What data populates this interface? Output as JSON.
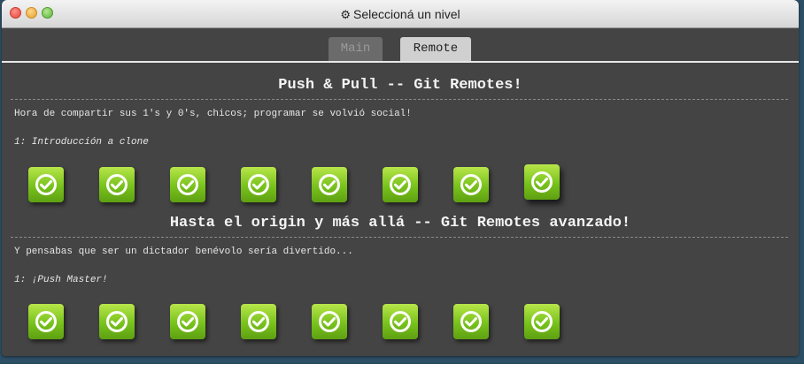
{
  "window": {
    "title_icon": "gear-icon",
    "title": "Seleccioná un nivel"
  },
  "tabs": [
    {
      "label": "Main",
      "active": false
    },
    {
      "label": "Remote",
      "active": true
    }
  ],
  "sections": [
    {
      "title": "Push & Pull -- Git Remotes!",
      "description": "Hora de compartir sus 1's y 0's, chicos; programar se volvió social!",
      "subtitle": "1: Introducción a clone",
      "levels": [
        {
          "status": "completed"
        },
        {
          "status": "completed"
        },
        {
          "status": "completed"
        },
        {
          "status": "completed"
        },
        {
          "status": "completed"
        },
        {
          "status": "completed"
        },
        {
          "status": "completed"
        },
        {
          "status": "completed"
        }
      ]
    },
    {
      "title": "Hasta el origin y más allá -- Git Remotes avanzado!",
      "description": "Y pensabas que ser un dictador benévolo sería divertido...",
      "subtitle": "1: ¡Push Master!",
      "levels": [
        {
          "status": "completed"
        },
        {
          "status": "completed"
        },
        {
          "status": "completed"
        },
        {
          "status": "completed"
        },
        {
          "status": "completed"
        },
        {
          "status": "completed"
        },
        {
          "status": "completed"
        },
        {
          "status": "completed"
        }
      ]
    }
  ],
  "colors": {
    "window_bg": "#444444",
    "level_green": "#78c21c",
    "backdrop": "#2d4f66"
  }
}
